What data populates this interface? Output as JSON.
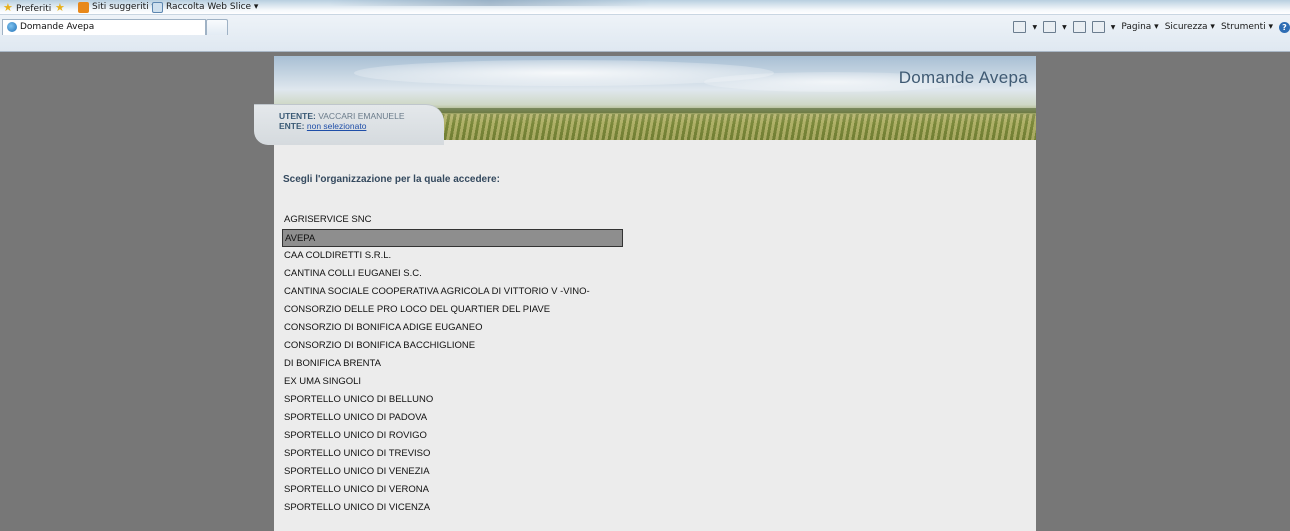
{
  "browser": {
    "favorites_bar": {
      "favorites_label": "Preferiti",
      "suggested_sites_label": "Siti suggeriti ▾",
      "web_slice_label": "Raccolta Web Slice ▾"
    },
    "tab": {
      "title": "Domande Avepa"
    },
    "command_bar": {
      "page_label": "Pagina ▾",
      "security_label": "Sicurezza ▾",
      "tools_label": "Strumenti ▾",
      "help_label": "?"
    }
  },
  "page": {
    "banner_title": "Domande Avepa",
    "user": {
      "user_key": "UTENTE:",
      "user_value": "VACCARI EMANUELE",
      "ente_key": "ENTE:",
      "ente_value": "non selezionato"
    },
    "prompt": "Scegli l'organizzazione per la quale accedere:",
    "organizations": [
      "AGRISERVICE SNC",
      "AVEPA",
      "CAA COLDIRETTI S.R.L.",
      "CANTINA COLLI EUGANEI S.C.",
      "CANTINA SOCIALE COOPERATIVA AGRICOLA DI VITTORIO V -VINO-",
      "CONSORZIO DELLE PRO LOCO DEL QUARTIER DEL PIAVE",
      "CONSORZIO DI BONIFICA ADIGE EUGANEO",
      "CONSORZIO DI BONIFICA BACCHIGLIONE",
      "DI BONIFICA BRENTA",
      "EX UMA SINGOLI",
      "SPORTELLO UNICO DI BELLUNO",
      "SPORTELLO UNICO DI PADOVA",
      "SPORTELLO UNICO DI ROVIGO",
      "SPORTELLO UNICO DI TREVISO",
      "SPORTELLO UNICO DI VENEZIA",
      "SPORTELLO UNICO DI VERONA",
      "SPORTELLO UNICO DI VICENZA"
    ],
    "selected_organization": "AVEPA"
  }
}
